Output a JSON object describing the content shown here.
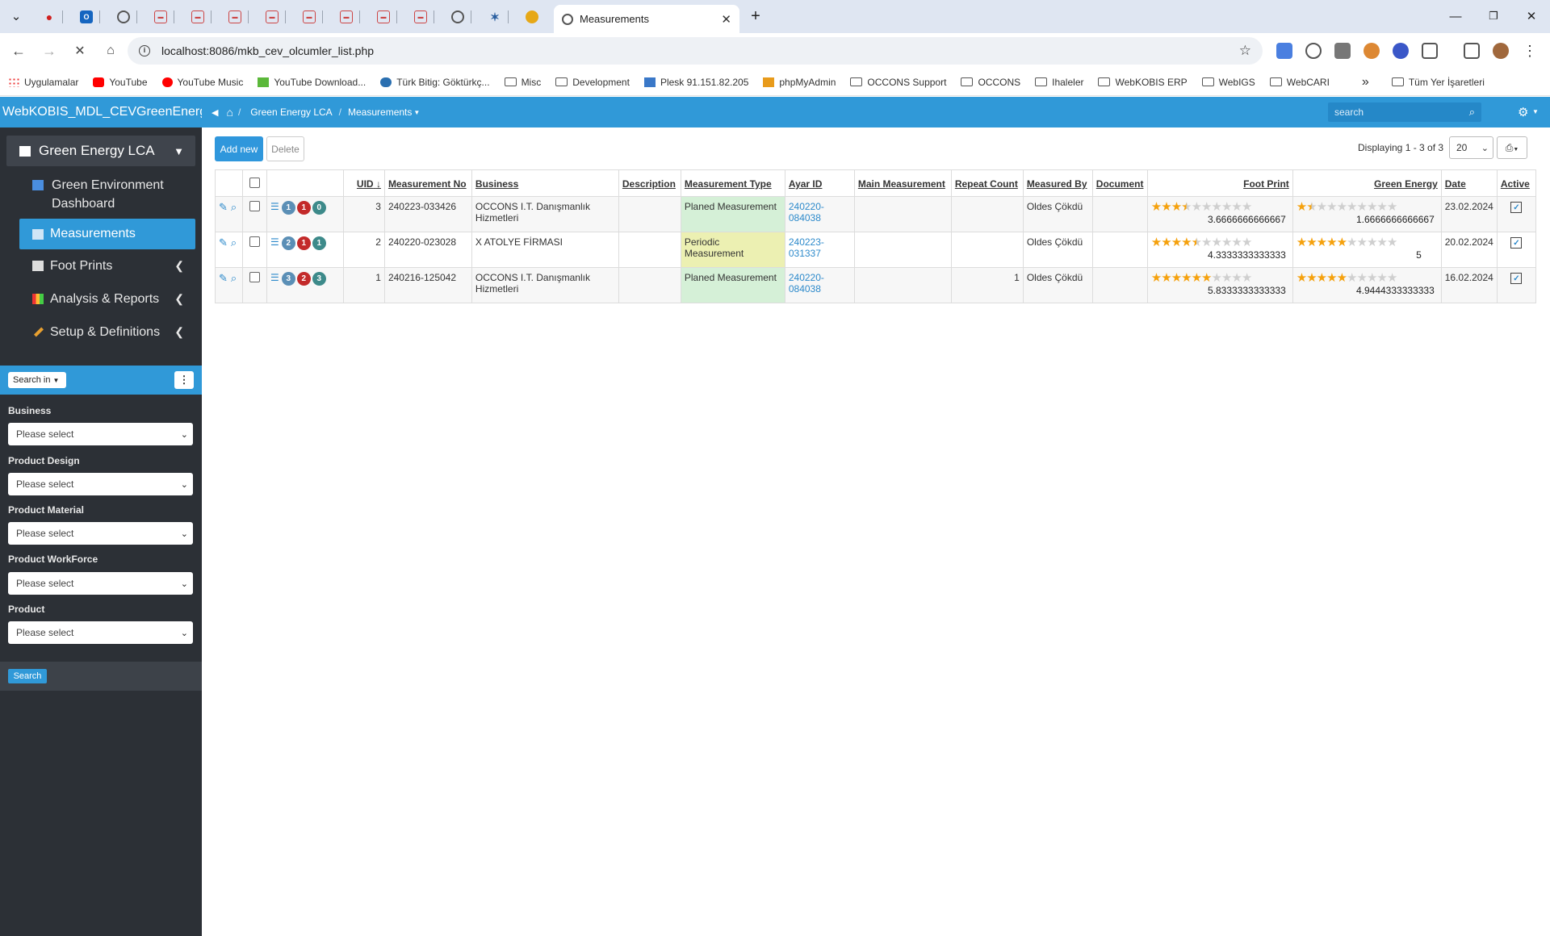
{
  "browser": {
    "active_tab_title": "Measurements",
    "url": "localhost:8086/mkb_cev_olcumler_list.php",
    "bookmarks": [
      "Uygulamalar",
      "YouTube",
      "YouTube Music",
      "YouTube Download...",
      "Türk Bitig: Göktürkç...",
      "Misc",
      "Development",
      "Plesk 91.151.82.205",
      "phpMyAdmin",
      "OCCONS Support",
      "OCCONS",
      "Ihaleler",
      "WebKOBIS ERP",
      "WebIGS",
      "WebCARI"
    ],
    "all_bookmarks": "Tüm Yer İşaretleri",
    "overflow": "»"
  },
  "app": {
    "brand": "WebKOBIS_MDL_CEVGreenEnergy",
    "menu_main": "Green Energy LCA",
    "menu_items": [
      {
        "label": "Green Environment Dashboard",
        "icon": "dashboard-icon"
      },
      {
        "label": "Measurements",
        "icon": "table-icon"
      },
      {
        "label": "Foot Prints",
        "icon": "table-icon"
      },
      {
        "label": "Analysis & Reports",
        "icon": "chart-icon"
      },
      {
        "label": "Setup & Definitions",
        "icon": "wrench-icon"
      }
    ],
    "breadcrumb": [
      "Green Energy LCA",
      "Measurements"
    ],
    "top_search_placeholder": "search"
  },
  "filters": {
    "search_in": "Search in",
    "labels": [
      "Business",
      "Product Design",
      "Product Material",
      "Product WorkForce",
      "Product"
    ],
    "placeholder": "Please select",
    "search_button": "Search"
  },
  "toolbar": {
    "add_new": "Add new",
    "delete": "Delete",
    "displaying": "Displaying 1 - 3 of 3",
    "page_size": "20"
  },
  "table": {
    "headers": [
      "UID",
      "Measurement No",
      "Business",
      "Description",
      "Measurement Type",
      "Ayar ID",
      "Main Measurement",
      "Repeat Count",
      "Measured By",
      "Document",
      "Foot Print",
      "Green Energy",
      "Date",
      "Active"
    ],
    "rows": [
      {
        "badges": [
          "1",
          "1",
          "0"
        ],
        "uid": "3",
        "no": "240223-033426",
        "business": "OCCONS I.T. Danışmanlık Hizmetleri",
        "description": "",
        "type": "Planed Measurement",
        "ayar": "240220-084038",
        "main": "",
        "repeat": "",
        "by": "Oldes Çökdü",
        "doc": "",
        "fp_stars": 3.67,
        "fp": "3.6666666666667",
        "ge_stars": 1.67,
        "ge": "1.6666666666667",
        "date": "23.02.2024",
        "active": true
      },
      {
        "badges": [
          "2",
          "1",
          "1"
        ],
        "uid": "2",
        "no": "240220-023028",
        "business": "X ATOLYE FİRMASI",
        "description": "",
        "type": "Periodic Measurement",
        "ayar": "240223-031337",
        "main": "",
        "repeat": "",
        "by": "Oldes Çökdü",
        "doc": "",
        "fp_stars": 4.33,
        "fp": "4.3333333333333",
        "ge_stars": 5,
        "ge": "5",
        "date": "20.02.2024",
        "active": true
      },
      {
        "badges": [
          "3",
          "2",
          "3"
        ],
        "uid": "1",
        "no": "240216-125042",
        "business": "OCCONS I.T. Danışmanlık Hizmetleri",
        "description": "",
        "type": "Planed Measurement",
        "ayar": "240220-084038",
        "main": "",
        "repeat": "1",
        "by": "Oldes Çökdü",
        "doc": "",
        "fp_stars": 5.83,
        "fp": "5.8333333333333",
        "ge_stars": 4.94,
        "ge": "4.9444333333333",
        "date": "16.02.2024",
        "active": true
      }
    ]
  },
  "colors": {
    "accent": "#3099d8",
    "sidebar": "#2c3036",
    "planed": "#d5f0d7",
    "periodic": "#ecf0b2",
    "star": "#f5a10d"
  }
}
